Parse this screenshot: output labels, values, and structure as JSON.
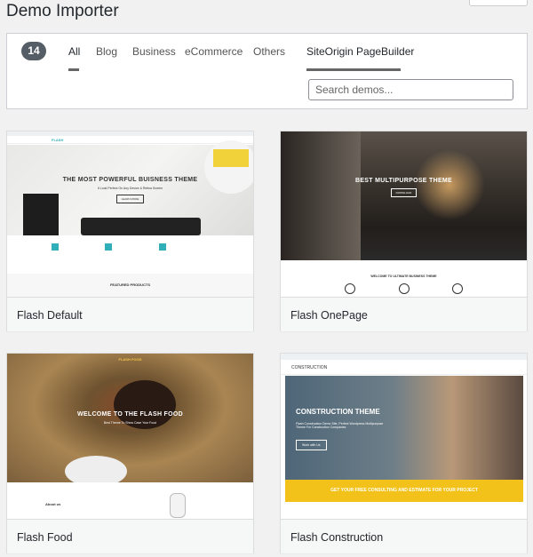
{
  "page": {
    "title": "Demo Importer"
  },
  "filter": {
    "count": "14",
    "tabs": [
      {
        "label": "All",
        "active": true
      },
      {
        "label": "Blog"
      },
      {
        "label": "Business"
      },
      {
        "label": "eCommerce"
      },
      {
        "label": "Others"
      },
      {
        "label": "SiteOrigin PageBuilder",
        "active": true
      }
    ],
    "search_placeholder": "Search demos..."
  },
  "demos": [
    {
      "name": "Flash Default",
      "hero_title": "THE MOST POWERFUL BUISNESS THEME",
      "hero_sub": "It Look Perfect On Any Device & Retina Screen",
      "hero_button": "LEARN MORE",
      "section": "FEATURED PRODUCTS",
      "logo": "FLASH"
    },
    {
      "name": "Flash OnePage",
      "hero_title": "BEST MULTIPURPOSE THEME",
      "hero_button": "DOWNLOAD",
      "section": "WELCOME TO ULTIMATE BUSINESS THEME"
    },
    {
      "name": "Flash Food",
      "hero_title": "WELCOME TO THE FLASH FOOD",
      "hero_sub": "Best Theme To Show Case Your Food",
      "section": "About us",
      "logo": "FLASH FOOD"
    },
    {
      "name": "Flash Construction",
      "hero_title": "CONSTRUCTION THEME",
      "hero_sub": "Flash Construction Demo Site, Perfect Wordpress Multipurpose Theme For Construction Companies",
      "hero_button": "Work with Us",
      "banner": "GET YOUR FREE CONSULTING AND ESTIMATE FOR YOUR PROJECT",
      "logo": "CONSTRUCTION"
    }
  ],
  "colors": {
    "accent": "#30afb8",
    "construction_yellow": "#f2c21a",
    "badge": "#555d66"
  }
}
